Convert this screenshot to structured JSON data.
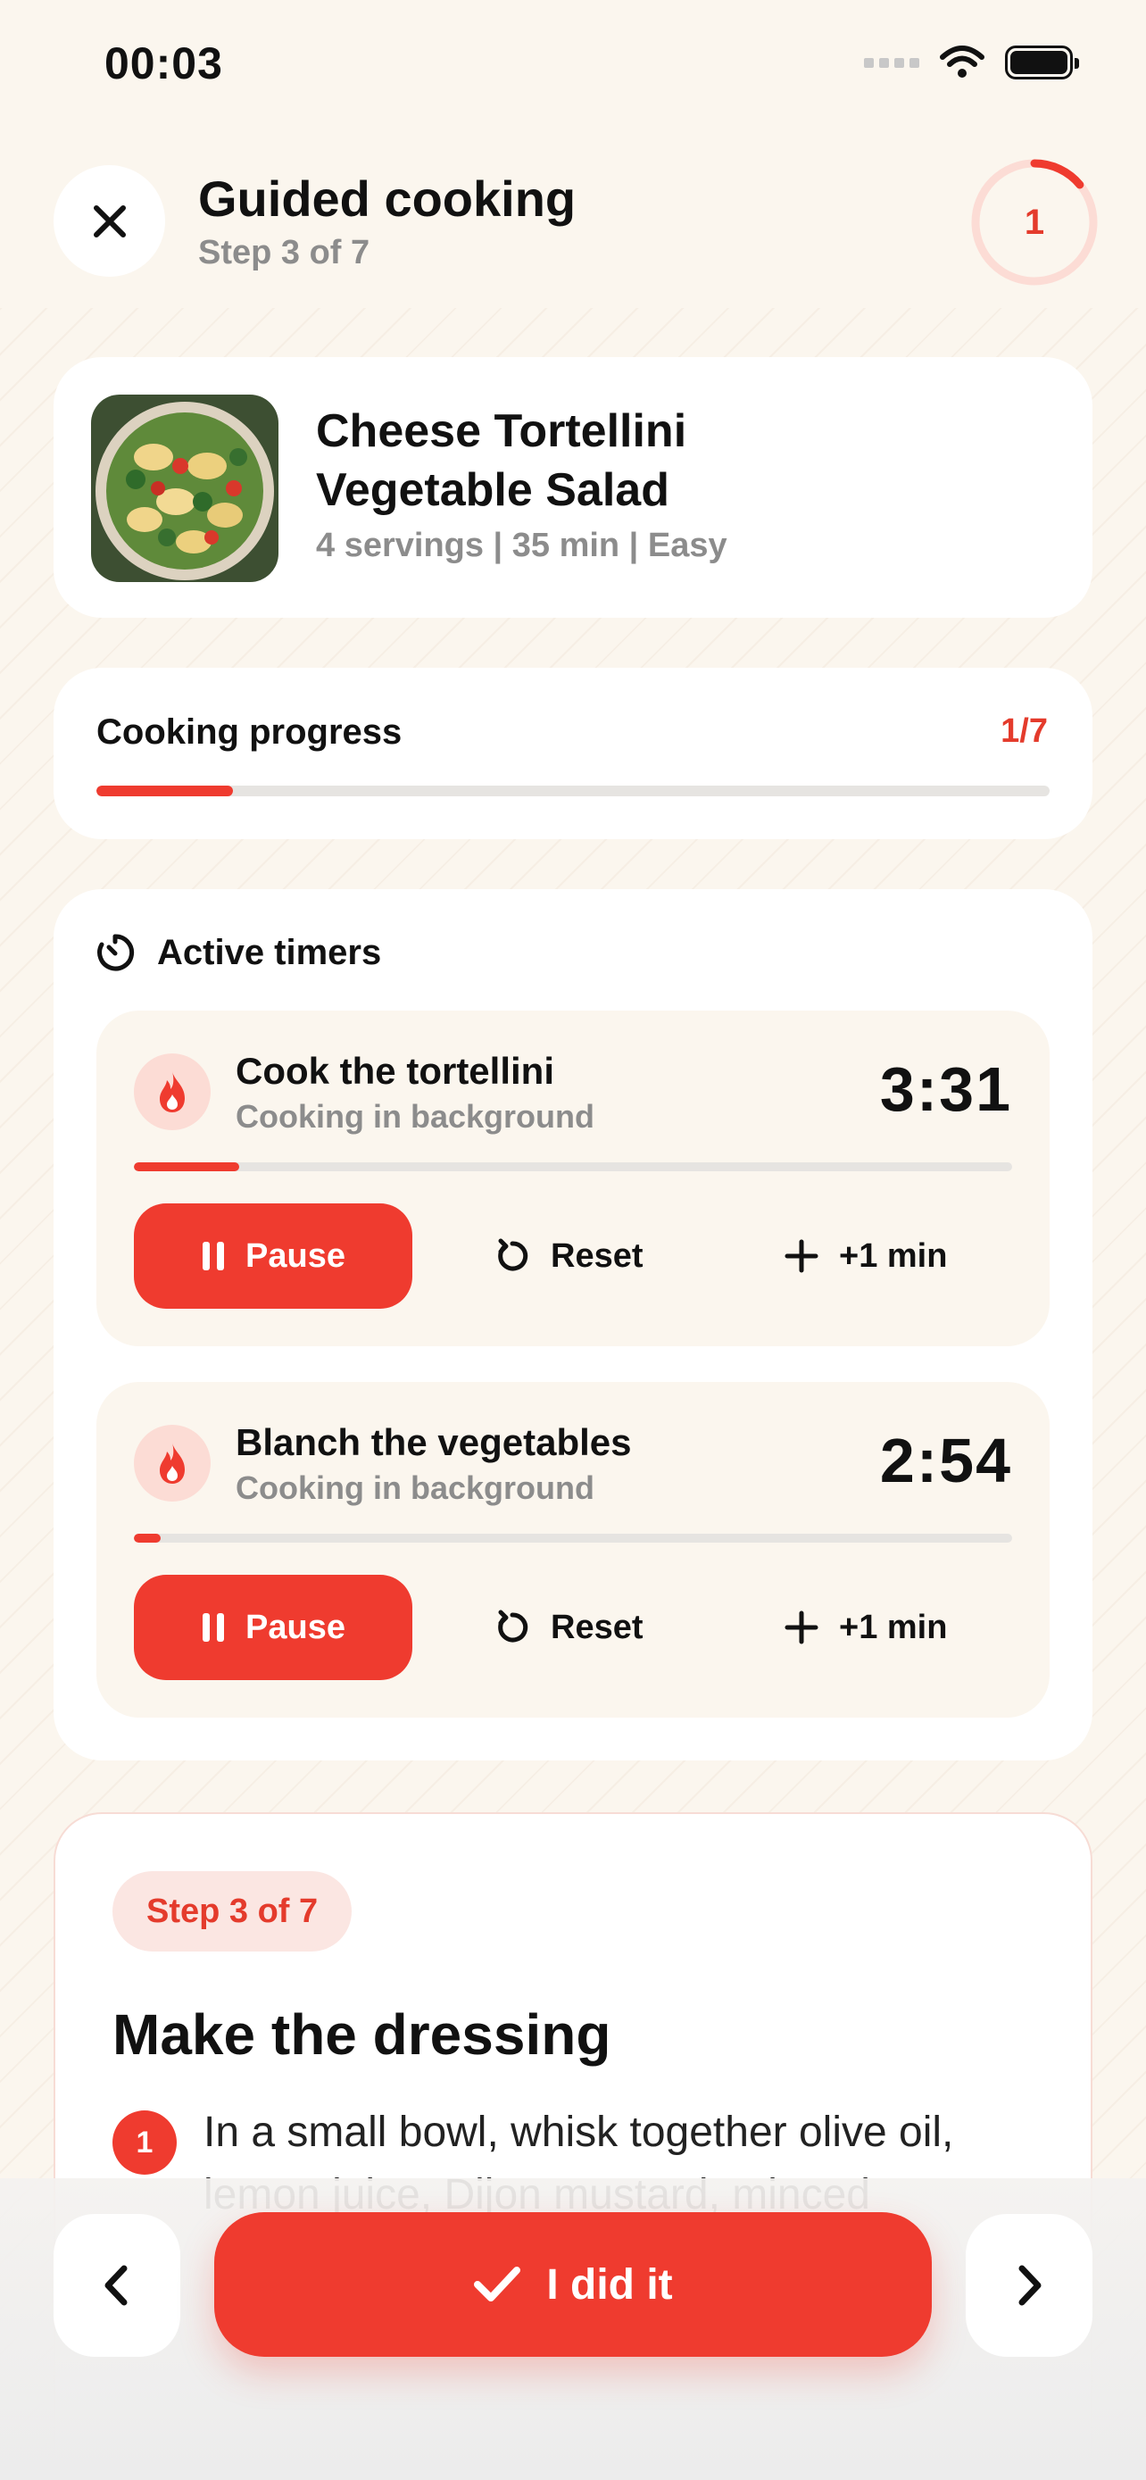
{
  "status_bar": {
    "time": "00:03"
  },
  "header": {
    "title": "Guided cooking",
    "subtitle": "Step 3 of 7",
    "ring_number": "1",
    "ring_progress": 0.14
  },
  "recipe": {
    "title_line1": "Cheese Tortellini",
    "title_line2": "Vegetable Salad",
    "meta": "4 servings | 35 min | Easy"
  },
  "progress": {
    "label": "Cooking progress",
    "count": "1/7",
    "fraction": 0.1428
  },
  "timers": {
    "title": "Active timers",
    "items": [
      {
        "name": "Cook the tortellini",
        "status": "Cooking in background",
        "time": "3:31",
        "progress": 0.12,
        "pause_label": "Pause",
        "reset_label": "Reset",
        "add_label": "+1 min"
      },
      {
        "name": "Blanch the vegetables",
        "status": "Cooking in background",
        "time": "2:54",
        "progress": 0.03,
        "pause_label": "Pause",
        "reset_label": "Reset",
        "add_label": "+1 min"
      }
    ]
  },
  "step": {
    "pill": "Step 3 of 7",
    "title": "Make the dressing",
    "instruction_number": "1",
    "instruction_text": "In a small bowl, whisk together olive oil, lemon juice, Dijon mustard, minced"
  },
  "actions": {
    "primary_label": "I did it"
  },
  "colors": {
    "accent": "#ef3b2f",
    "background": "#fbf6ee",
    "muted_text": "#8c8c8c"
  },
  "icons": {
    "close": "close-icon",
    "timer": "timer-icon",
    "flame": "flame-icon",
    "pause": "pause-icon",
    "reset": "reset-icon",
    "plus": "plus-icon",
    "check": "check-icon",
    "prev": "chevron-left-icon",
    "next": "chevron-right-icon"
  }
}
